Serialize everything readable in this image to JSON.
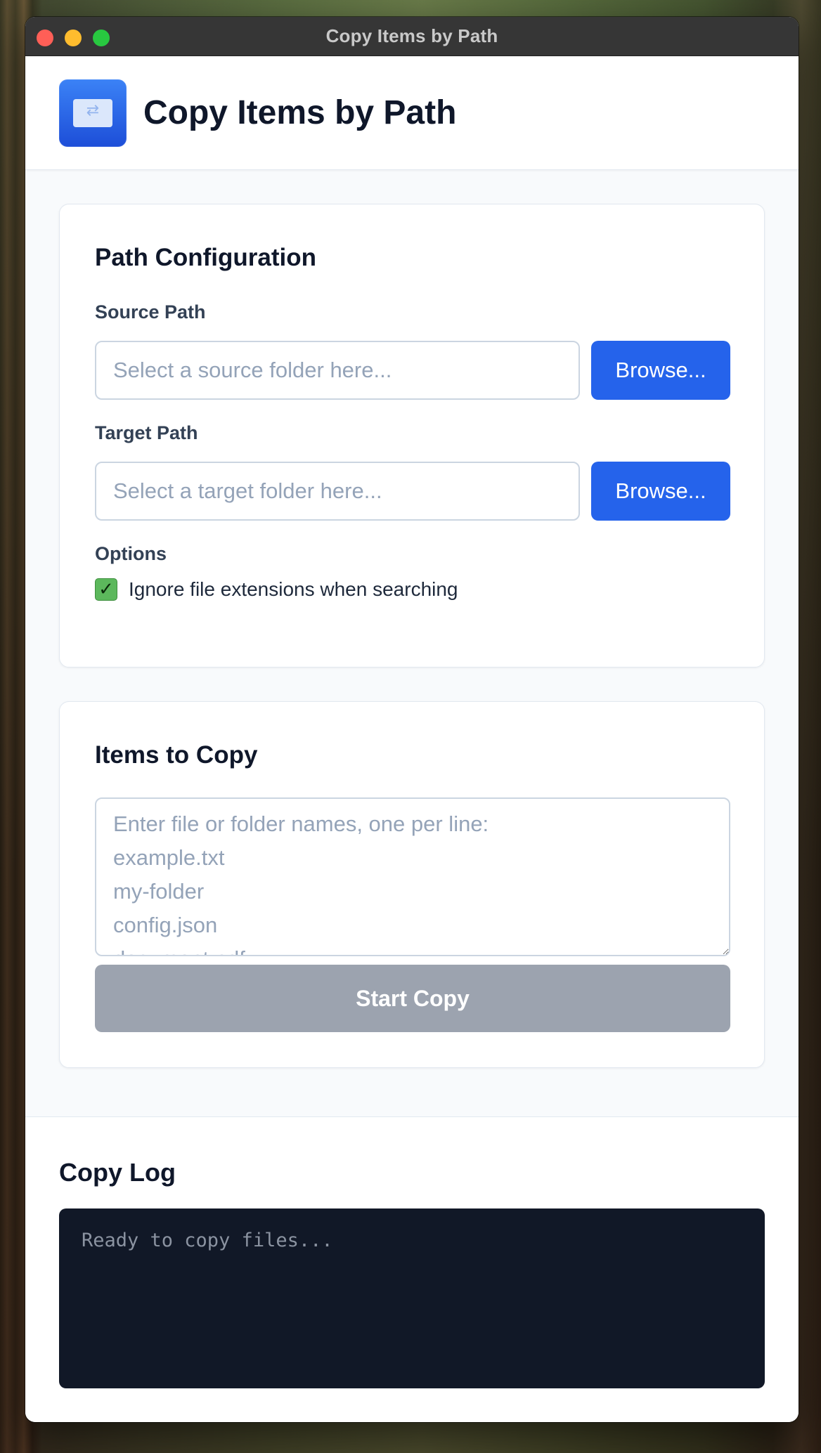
{
  "window": {
    "title": "Copy Items by Path"
  },
  "header": {
    "title": "Copy Items by Path",
    "logo_icon": "copy-document-icon"
  },
  "path_config": {
    "title": "Path Configuration",
    "source_label": "Source Path",
    "source_placeholder": "Select a source folder here...",
    "source_value": "",
    "target_label": "Target Path",
    "target_placeholder": "Select a target folder here...",
    "target_value": "",
    "browse_label": "Browse...",
    "options_label": "Options",
    "ignore_ext_label": "Ignore file extensions when searching",
    "ignore_ext_checked": true
  },
  "items": {
    "title": "Items to Copy",
    "placeholder": "Enter file or folder names, one per line:\nexample.txt\nmy-folder\nconfig.json\ndocument.pdf",
    "value": "",
    "start_label": "Start Copy",
    "start_enabled": false
  },
  "log": {
    "title": "Copy Log",
    "text": "Ready to copy files..."
  },
  "colors": {
    "accent": "#2563eb",
    "disabled_button": "#9ca3af",
    "checkbox": "#5cb85c",
    "log_background": "#111827"
  }
}
